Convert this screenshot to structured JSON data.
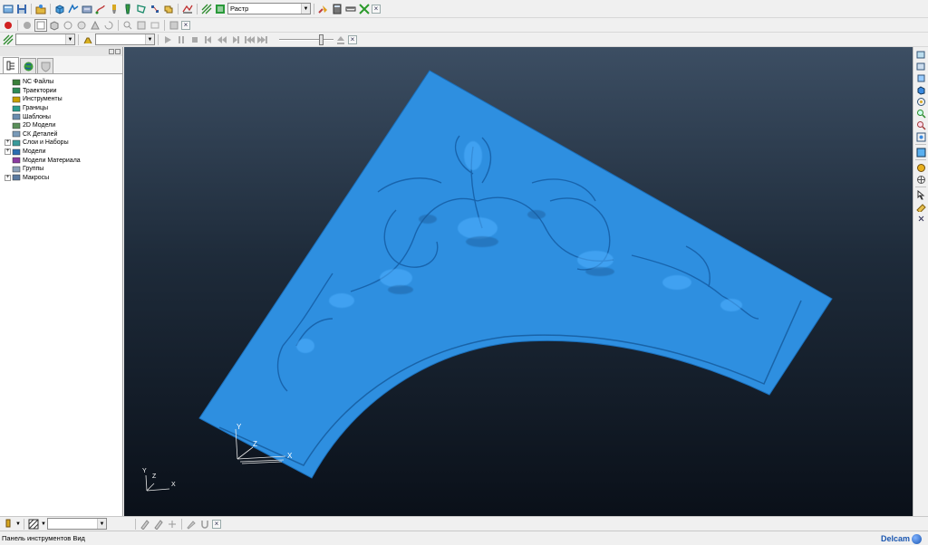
{
  "toolbar_main": {
    "strategy_combo_value": "Растр",
    "close_label": "×"
  },
  "toolbar_second": {
    "close_label": "×"
  },
  "toolbar_simulation": {
    "combo1_value": "",
    "combo2_value": "",
    "close_label": "×"
  },
  "explorer": {
    "tree": [
      {
        "label": "NC Файлы",
        "expandable": false,
        "icon": "nc-files-icon",
        "color": "#3a7f3a"
      },
      {
        "label": "Траектории",
        "expandable": false,
        "icon": "toolpaths-icon",
        "color": "#2e8b57"
      },
      {
        "label": "Инструменты",
        "expandable": false,
        "icon": "tools-icon",
        "color": "#c8a000"
      },
      {
        "label": "Границы",
        "expandable": false,
        "icon": "boundaries-icon",
        "color": "#2a9d8f"
      },
      {
        "label": "Шаблоны",
        "expandable": false,
        "icon": "patterns-icon",
        "color": "#6a8caf"
      },
      {
        "label": "2D Модели",
        "expandable": false,
        "icon": "2d-models-icon",
        "color": "#5a8f5a"
      },
      {
        "label": "СК Деталей",
        "expandable": false,
        "icon": "workplanes-icon",
        "color": "#7a9ab8"
      },
      {
        "label": "Слои и Наборы",
        "expandable": true,
        "icon": "levels-sets-icon",
        "color": "#3a9a9a"
      },
      {
        "label": "Модели",
        "expandable": true,
        "icon": "models-icon",
        "color": "#2a6db0"
      },
      {
        "label": "Модели Материала",
        "expandable": false,
        "icon": "stock-models-icon",
        "color": "#8a3aa0"
      },
      {
        "label": "Группы",
        "expandable": false,
        "icon": "groups-icon",
        "color": "#8aa0b8"
      },
      {
        "label": "Макросы",
        "expandable": true,
        "icon": "macros-icon",
        "color": "#5a7aa0"
      }
    ]
  },
  "viewport": {
    "model_color": "#2e8fe0",
    "triad_model": {
      "x": "X",
      "y": "Y",
      "z": "Z"
    },
    "triad_view": {
      "x": "X",
      "y": "Y",
      "z": "Z"
    }
  },
  "bottom_toolbar": {
    "combo_value": "",
    "close_label": "×"
  },
  "status": {
    "text": "Панель инструментов Вид",
    "brand": "Delcam"
  }
}
